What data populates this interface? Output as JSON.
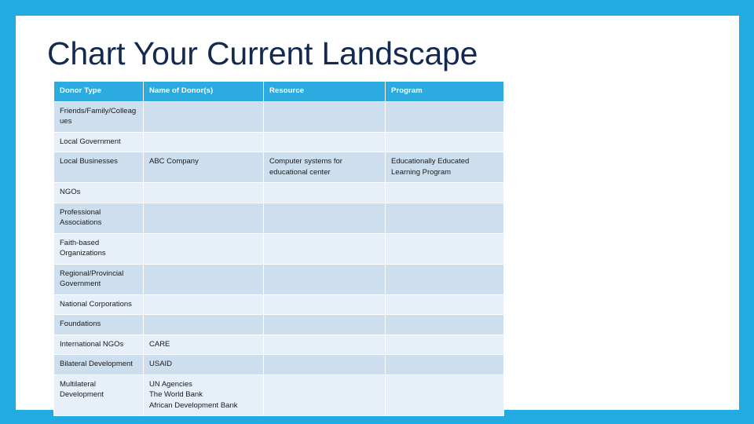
{
  "slide": {
    "title": "Chart Your Current Landscape",
    "border_color": "#22ABE2",
    "background_color": "#FFFFFF",
    "title_color": "#14294F"
  },
  "table": {
    "header_bg": "#2BABE0",
    "header_text_color": "#FFFFFF",
    "row_dark_bg": "#CDDFEF",
    "row_light_bg": "#E7F0F9",
    "headers": [
      "Donor Type",
      "Name of Donor(s)",
      "Resource",
      "Program"
    ],
    "rows": [
      {
        "donor_type": "Friends/Family/Colleagues",
        "name_of_donors": "",
        "resource": "",
        "program": ""
      },
      {
        "donor_type": "Local Government",
        "name_of_donors": "",
        "resource": "",
        "program": ""
      },
      {
        "donor_type": "Local Businesses",
        "name_of_donors": "ABC Company",
        "resource": "Computer systems for educational center",
        "program": "Educationally Educated Learning Program"
      },
      {
        "donor_type": "NGOs",
        "name_of_donors": "",
        "resource": "",
        "program": ""
      },
      {
        "donor_type": "Professional Associations",
        "name_of_donors": "",
        "resource": "",
        "program": ""
      },
      {
        "donor_type": "Faith-based Organizations",
        "name_of_donors": "",
        "resource": "",
        "program": ""
      },
      {
        "donor_type": "Regional/Provincial Government",
        "name_of_donors": "",
        "resource": "",
        "program": ""
      },
      {
        "donor_type": "National Corporations",
        "name_of_donors": "",
        "resource": "",
        "program": ""
      },
      {
        "donor_type": "Foundations",
        "name_of_donors": "",
        "resource": "",
        "program": ""
      },
      {
        "donor_type": "International NGOs",
        "name_of_donors": "CARE",
        "resource": "",
        "program": ""
      },
      {
        "donor_type": "Bilateral Development",
        "name_of_donors": "USAID",
        "resource": "",
        "program": ""
      },
      {
        "donor_type": "Multilateral Development",
        "name_of_donors": "UN Agencies\nThe World Bank\nAfrican Development Bank",
        "resource": "",
        "program": ""
      }
    ]
  }
}
